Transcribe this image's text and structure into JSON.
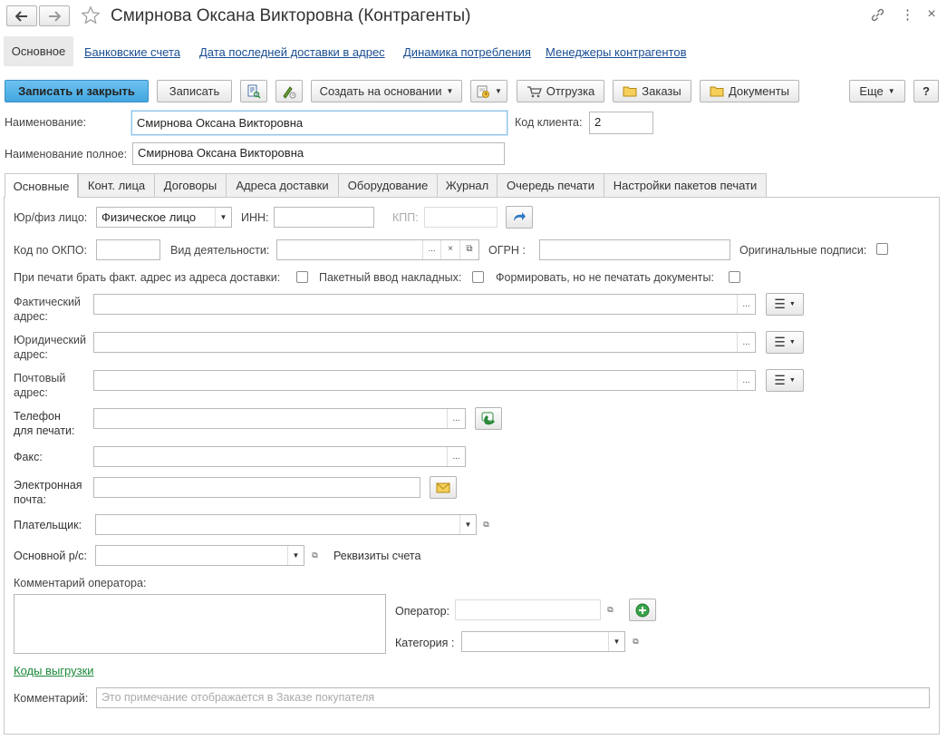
{
  "window": {
    "title": "Смирнова Оксана Викторовна (Контрагенты)",
    "back_icon": "arrow-left-icon",
    "forward_icon": "arrow-right-icon",
    "star_icon": "star-icon",
    "link_icon": "link-icon",
    "more_icon": "more-vertical-icon",
    "close_icon": "close-icon"
  },
  "nav": {
    "items": [
      "Основное",
      "Банковские счета",
      "Дата последней доставки в адрес",
      "Динамика потребления",
      "Менеджеры контрагентов"
    ]
  },
  "toolbar": {
    "save_close": "Записать и закрыть",
    "save": "Записать",
    "create_based": "Создать на основании",
    "shipment": "Отгрузка",
    "orders": "Заказы",
    "documents": "Документы",
    "more": "Еще",
    "help": "?"
  },
  "header": {
    "name_label": "Наименование:",
    "name_value": "Смирнова Оксана Викторовна",
    "client_code_label": "Код клиента:",
    "client_code_value": "2",
    "full_name_label": "Наименование полное:",
    "full_name_value": "Смирнова Оксана Викторовна"
  },
  "tabs": [
    "Основные",
    "Конт. лица",
    "Договоры",
    "Адреса доставки",
    "Оборудование",
    "Журнал",
    "Очередь печати",
    "Настройки пакетов печати"
  ],
  "main": {
    "entity_type_label": "Юр/физ  лицо:",
    "entity_type_value": "Физическое лицо",
    "inn_label": "ИНН:",
    "inn_value": "",
    "kpp_label": "КПП:",
    "kpp_value": "",
    "okpo_label": "Код по ОКПО:",
    "okpo_value": "",
    "activity_label": "Вид деятельности:",
    "activity_value": "",
    "ogrn_label": "ОГРН   :",
    "ogrn_value": "",
    "original_signatures_label": "Оригинальные подписи:",
    "print_actual_address_label": "При печати брать факт. адрес из адреса доставки:",
    "batch_input_label": "Пакетный ввод накладных:",
    "form_no_print_label": "Формировать, но не печатать документы:",
    "actual_address_label_1": "Фактический",
    "actual_address_label_2": "адрес:",
    "legal_address_label_1": "Юридический",
    "legal_address_label_2": "адрес:",
    "postal_address_label_1": "Почтовый",
    "postal_address_label_2": "адрес:",
    "phone_label_1": "Телефон",
    "phone_label_2": "для печати:",
    "fax_label": "Факс:",
    "email_label_1": "Электронная",
    "email_label_2": "почта:",
    "payer_label": "Плательщик:",
    "payer_value": "",
    "main_account_label": "Основной р/с:",
    "main_account_value": "",
    "account_details_label": "Реквизиты счета",
    "operator_comment_label": "Комментарий оператора:",
    "operator_label": "Оператор:",
    "operator_value": "",
    "category_label": "Категория :",
    "category_value": "",
    "export_codes_link": "Коды выгрузки",
    "comment_label": "Комментарий:",
    "comment_placeholder": "Это примечание отображается в Заказе покупателя"
  },
  "colors": {
    "primary_button": "#44a6df",
    "link": "#1a4e91",
    "green_link": "#1b8a3a"
  }
}
